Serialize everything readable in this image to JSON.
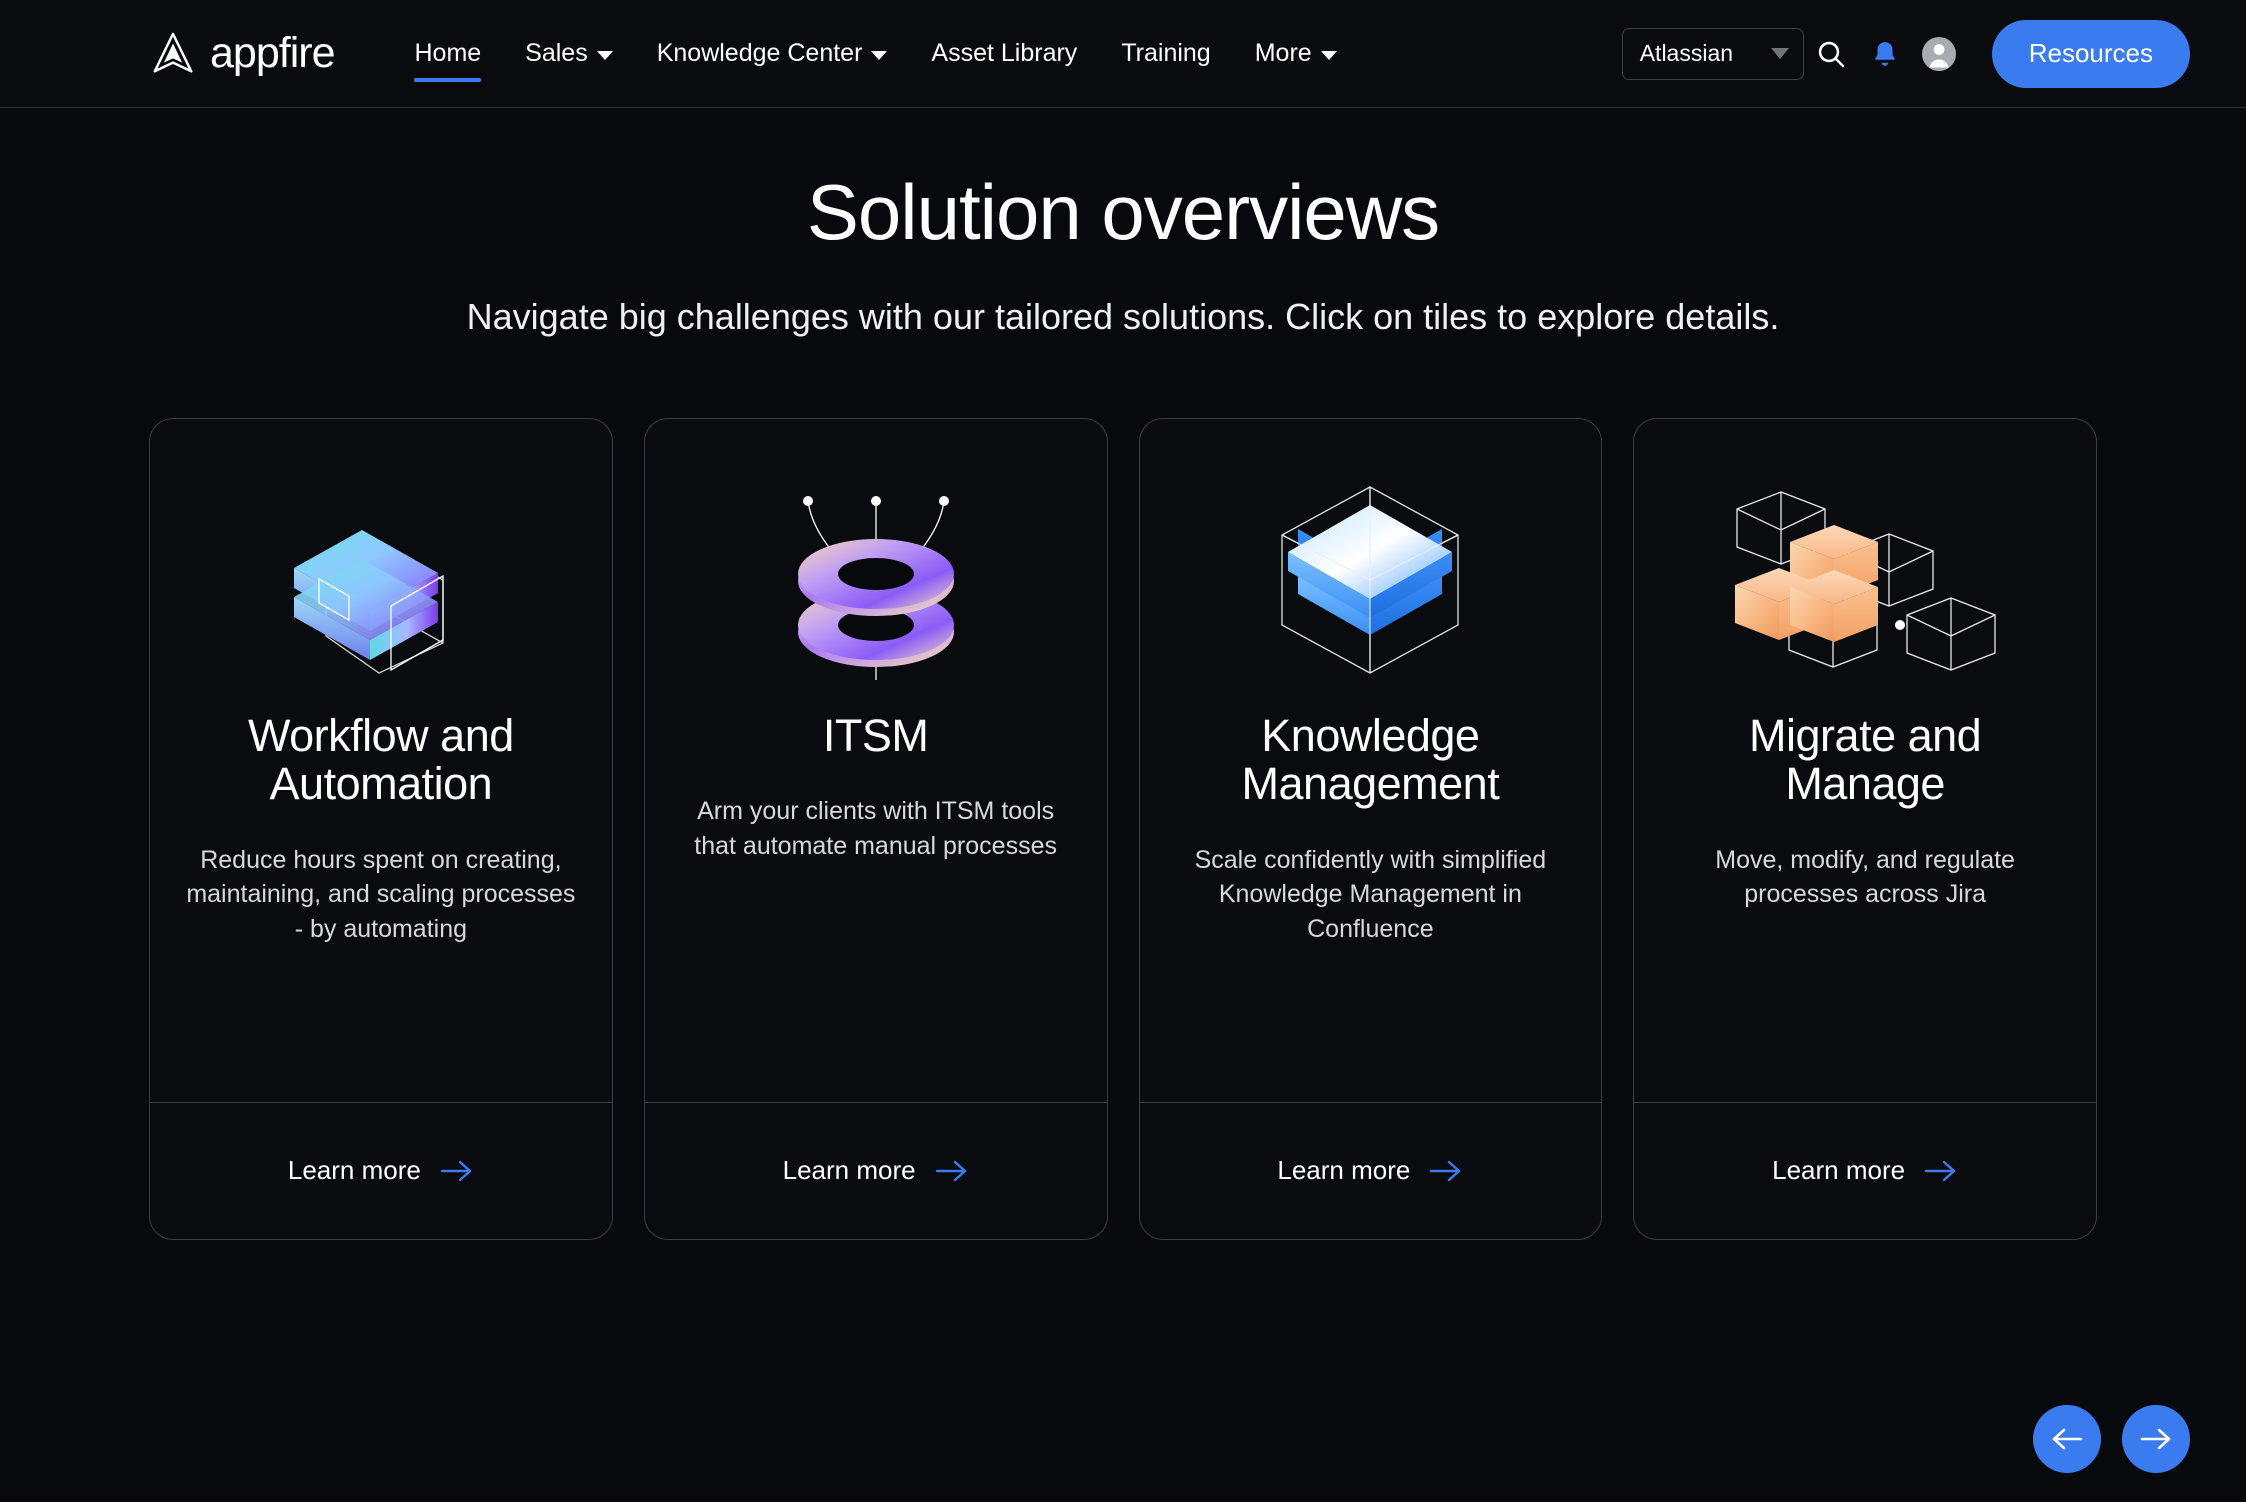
{
  "brand": {
    "logo_text": "appfire",
    "logo_icon": "appfire-triangle-logo",
    "accent_color": "#3b7bf0",
    "background_color": "#08090c"
  },
  "header": {
    "nav_items": [
      {
        "label": "Home",
        "has_dropdown": false,
        "active": true
      },
      {
        "label": "Sales",
        "has_dropdown": true,
        "active": false
      },
      {
        "label": "Knowledge Center",
        "has_dropdown": true,
        "active": false
      },
      {
        "label": "Asset Library",
        "has_dropdown": false,
        "active": false
      },
      {
        "label": "Training",
        "has_dropdown": false,
        "active": false
      },
      {
        "label": "More",
        "has_dropdown": true,
        "active": false
      }
    ],
    "region_select": {
      "value": "Atlassian",
      "icon": "chevron-down-icon"
    },
    "icons": [
      {
        "name": "search-icon",
        "color": "#ffffff"
      },
      {
        "name": "notification-bell-icon",
        "color": "#3b7bf0"
      },
      {
        "name": "user-avatar-icon",
        "color": "#a7abb2"
      }
    ],
    "resources_button": "Resources"
  },
  "hero": {
    "title": "Solution overviews",
    "subtitle": "Navigate big challenges with our tailored solutions. Click on tiles to explore details."
  },
  "cards": [
    {
      "art": "isometric-slab-illustration",
      "title": "Workflow and Automation",
      "description": "Reduce hours spent on creating, maintaining, and scaling processes - by automating",
      "learn_more": "Learn more",
      "arrow_icon": "arrow-right-icon"
    },
    {
      "art": "stacked-torus-illustration",
      "title": "ITSM",
      "description": "Arm your clients with ITSM tools that automate manual processes",
      "learn_more": "Learn more",
      "arrow_icon": "arrow-right-icon"
    },
    {
      "art": "layered-cube-illustration",
      "title": "Knowledge Management",
      "description": "Scale confidently with simplified Knowledge Management in Confluence",
      "learn_more": "Learn more",
      "arrow_icon": "arrow-right-icon"
    },
    {
      "art": "scattered-cubes-illustration",
      "title": "Migrate and Manage",
      "description": "Move, modify, and regulate processes across Jira",
      "learn_more": "Learn more",
      "arrow_icon": "arrow-right-icon"
    }
  ],
  "carousel": {
    "previous_icon": "arrow-left-icon",
    "next_icon": "arrow-right-icon"
  }
}
